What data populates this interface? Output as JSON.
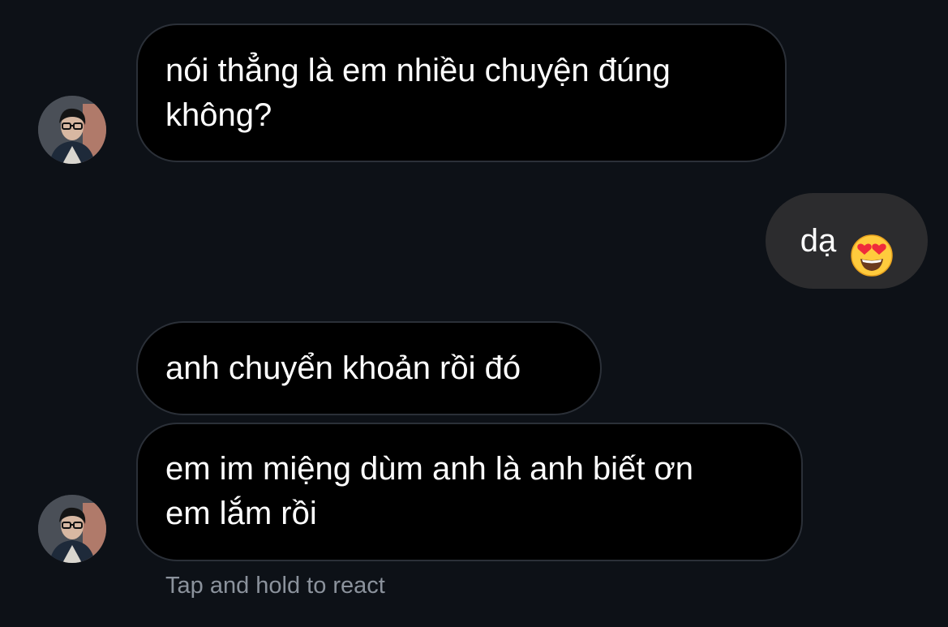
{
  "messages": [
    {
      "sender": "other",
      "text": "nói thẳng là em nhiều chuyện đúng không?",
      "line1": "nói thẳng là em nhiều chuyện đúng",
      "line2": "không?"
    },
    {
      "sender": "me",
      "text": "dạ",
      "emoji": "smiling-face-with-heart-eyes"
    },
    {
      "sender": "other",
      "text": "anh chuyển khoản rồi đó"
    },
    {
      "sender": "other",
      "text": "em im miệng dùm anh là anh biết ơn em lắm rồi",
      "line1": "em im miệng dùm anh là anh biết ơn",
      "line2": "em lắm rồi"
    }
  ],
  "hint": "Tap and hold to react",
  "colors": {
    "background": "#0d1117",
    "incoming_bubble": "#000000",
    "incoming_border": "#2b3038",
    "outgoing_bubble": "#2c2c2e",
    "hint_text": "#8b929c"
  }
}
